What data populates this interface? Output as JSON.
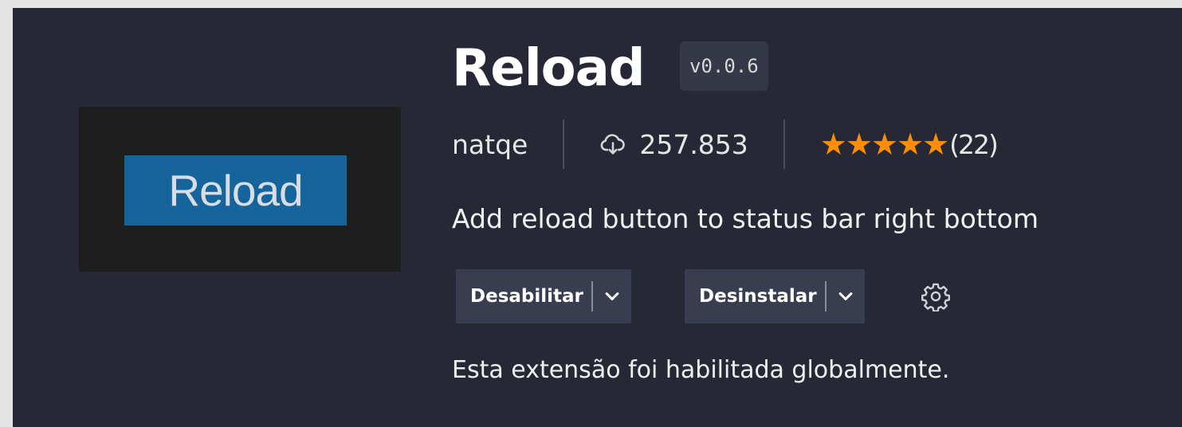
{
  "extension": {
    "icon_text": "Reload",
    "name": "Reload",
    "version": "v0.0.6",
    "publisher": "natqe",
    "installs": "257.853",
    "rating": {
      "stars": 5,
      "max_stars": 5,
      "stars_display": "★★★★★",
      "count": "(22)"
    },
    "description": "Add reload button to status bar right bottom",
    "status_note": "Esta extensão foi habilitada globalmente."
  },
  "actions": {
    "disable_label": "Desabilitar",
    "uninstall_label": "Desinstalar"
  },
  "icons": {
    "downloads": "cloud-download-icon",
    "caret": "chevron-down-icon",
    "settings": "gear-icon"
  },
  "colors": {
    "background": "#262935",
    "icon_badge": "#15649c",
    "star": "#ff8e00",
    "button": "#393d50"
  }
}
